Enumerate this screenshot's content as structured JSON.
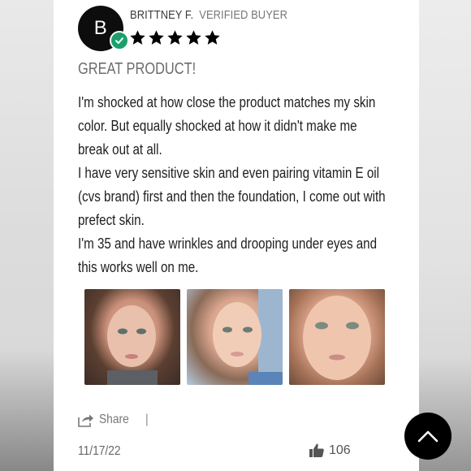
{
  "reviewer": {
    "initial": "B",
    "name": "BRITTNEY F.",
    "badge": "VERIFIED BUYER",
    "rating": 5,
    "rating_max": 5
  },
  "review": {
    "title": "GREAT PRODUCT!",
    "paragraphs": [
      "I'm shocked at how close the product matches my skin color. But equally shocked at how it didn't make me break out at all.",
      "I have very sensitive skin and even pairing vitamin E oil (cvs brand) first and then the foundation, I come out with prefect skin.",
      "I'm 35 and have wrinkles and drooping under eyes and this works well on me."
    ],
    "photo_count": 3
  },
  "footer": {
    "share_label": "Share",
    "separator": "|",
    "date": "11/17/22",
    "likes": "106"
  },
  "colors": {
    "avatar": "#0d0d0d",
    "verified": "#19a06b",
    "stars": "#000000",
    "scroll_button": "#000000"
  },
  "icons": [
    "verified-check-icon",
    "star-icon",
    "share-icon",
    "thumbs-up-icon",
    "chevron-up-icon"
  ]
}
